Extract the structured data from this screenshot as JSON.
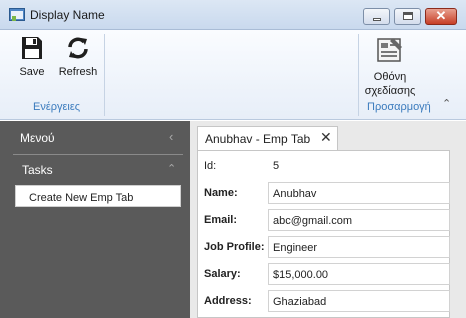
{
  "window": {
    "title": "Display Name"
  },
  "ribbon": {
    "save_label": "Save",
    "refresh_label": "Refresh",
    "actions_group": "Ενέργειες",
    "screen_design_line1": "Οθόνη",
    "screen_design_line2": "σχεδίασης",
    "customize_group": "Προσαρμογή"
  },
  "nav": {
    "menu_title": "Μενού",
    "tasks_title": "Tasks",
    "task_item": "Create New Emp Tab"
  },
  "tab": {
    "label": "Anubhav - Emp Tab"
  },
  "form": {
    "id_label": "Id:",
    "id_value": "5",
    "name_label": "Name:",
    "name_value": "Anubhav",
    "email_label": "Email:",
    "email_value": "abc@gmail.com",
    "job_label": "Job Profile:",
    "job_value": "Engineer",
    "salary_label": "Salary:",
    "salary_value": "$15,000.00",
    "address_label": "Address:",
    "address_value": "Ghaziabad"
  },
  "icons": {
    "app": "app-window-icon",
    "save": "floppy-disk-icon",
    "refresh": "refresh-icon",
    "screen_design": "screen-design-icon"
  }
}
